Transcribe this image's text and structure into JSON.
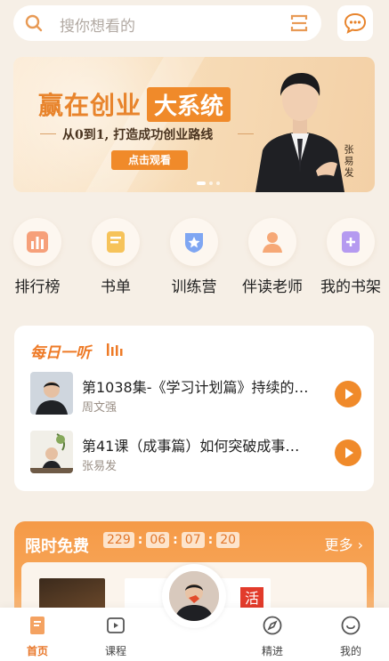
{
  "search": {
    "placeholder": "搜你想看的"
  },
  "banner": {
    "title_a": "赢在创业",
    "title_b": "大系统",
    "subtitle": "从0到1, 打造成功创业路线",
    "button": "点击观看",
    "name": "张易发"
  },
  "quick_links": [
    {
      "label": "排行榜",
      "icon": "ranking-icon"
    },
    {
      "label": "书单",
      "icon": "booklist-icon"
    },
    {
      "label": "训练营",
      "icon": "training-camp-icon"
    },
    {
      "label": "伴读老师",
      "icon": "tutor-icon"
    },
    {
      "label": "我的书架",
      "icon": "bookshelf-icon"
    }
  ],
  "daily": {
    "title": "每日一听",
    "episodes": [
      {
        "title": "第1038集-《学习计划篇》持续的…",
        "author": "周文强"
      },
      {
        "title": "第41课（成事篇）如何突破成事…",
        "author": "张易发"
      }
    ]
  },
  "free": {
    "title": "限时免费",
    "timer": [
      "229",
      "06",
      "07",
      "20"
    ],
    "more": "更多",
    "book2_char": "活"
  },
  "nav": {
    "items": [
      {
        "label": "首页",
        "active": true
      },
      {
        "label": "课程",
        "active": false
      },
      {
        "label": "精进",
        "active": false
      },
      {
        "label": "我的",
        "active": false
      }
    ]
  },
  "colors": {
    "accent": "#f08a2a",
    "background": "#f6efe6"
  }
}
